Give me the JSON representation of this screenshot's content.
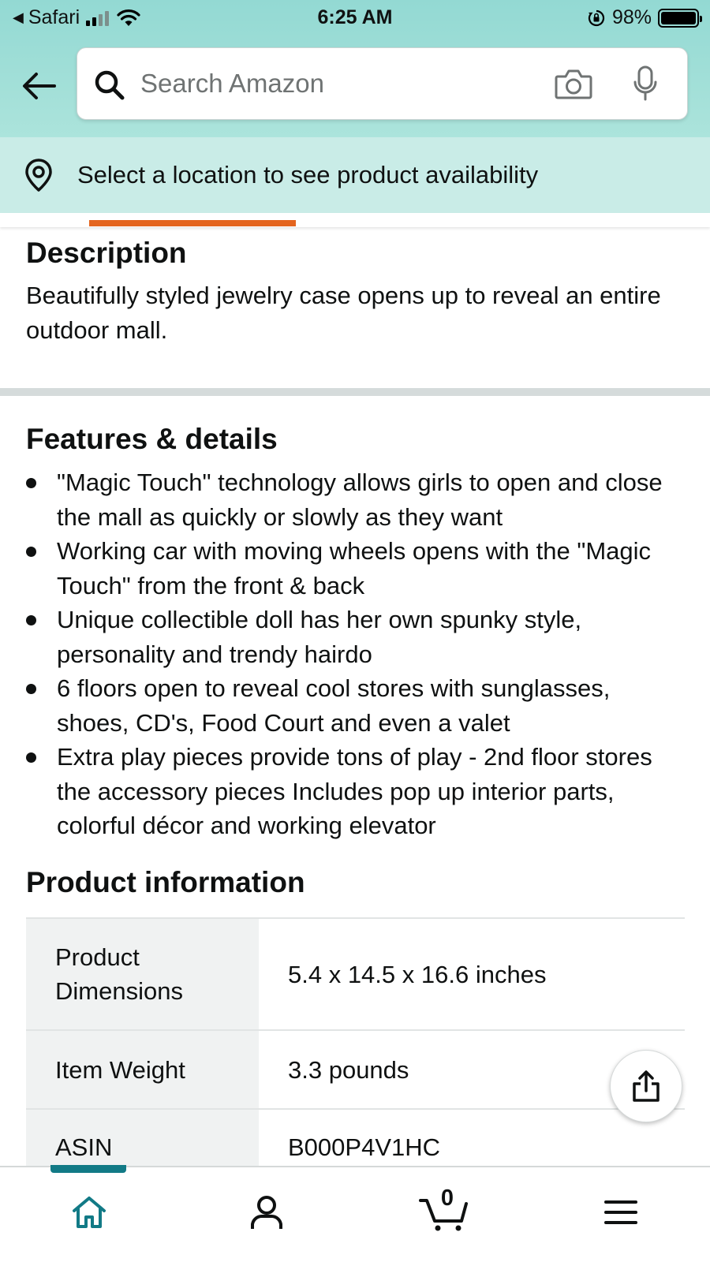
{
  "status_bar": {
    "back_app": "Safari",
    "time": "6:25 AM",
    "battery": "98%"
  },
  "search": {
    "placeholder": "Search Amazon"
  },
  "location": {
    "text": "Select a location to see product availability"
  },
  "description": {
    "title": "Description",
    "text": "Beautifully styled jewelry case opens up to reveal an entire outdoor mall."
  },
  "features": {
    "title": "Features & details",
    "items": [
      "\"Magic Touch\" technology allows girls to open and close the mall as quickly or slowly as they want",
      "Working car with moving wheels opens with the \"Magic Touch\" from the front & back",
      "Unique collectible doll has her own spunky style, personality and trendy hairdo",
      "6 floors open to reveal cool stores with sunglasses, shoes, CD's, Food Court and even a valet",
      "Extra play pieces provide tons of play - 2nd floor stores the accessory pieces Includes pop up interior parts, colorful décor and working elevator"
    ]
  },
  "product_info": {
    "title": "Product information",
    "rows": [
      {
        "key": "Product Dimensions",
        "value": "5.4 x 14.5 x 16.6 inches"
      },
      {
        "key": "Item Weight",
        "value": "3.3 pounds"
      },
      {
        "key": "ASIN",
        "value": "B000P4V1HC"
      }
    ]
  },
  "bottom_nav": {
    "cart_count": "0",
    "items": [
      "home-icon",
      "account-icon",
      "cart-icon",
      "menu-icon"
    ],
    "active_color": "#127a86"
  },
  "colors": {
    "tab_indicator": "#e4651f",
    "header_gradient_top": "#93d9d3",
    "location_bar": "#c9ece7"
  }
}
